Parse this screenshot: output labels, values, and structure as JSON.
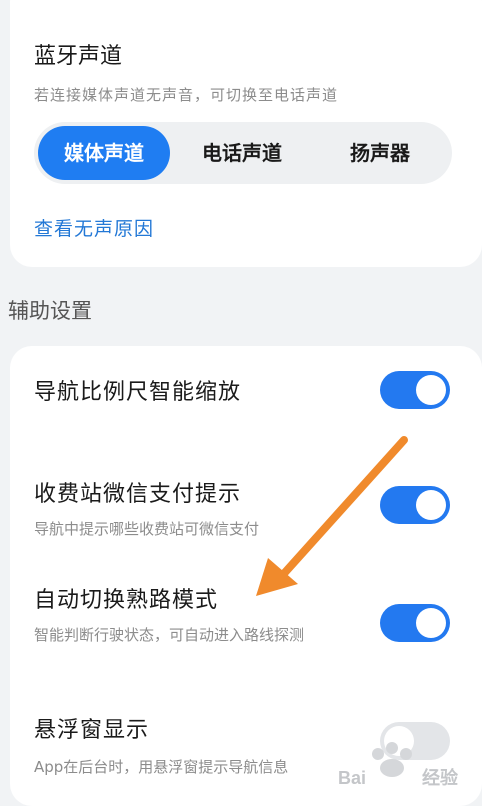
{
  "bluetooth": {
    "title": "蓝牙声道",
    "subtitle": "若连接媒体声道无声音，可切换至电话声道",
    "segments": [
      {
        "label": "媒体声道",
        "active": true
      },
      {
        "label": "电话声道",
        "active": false
      },
      {
        "label": "扬声器",
        "active": false
      }
    ],
    "link": "查看无声原因"
  },
  "aux": {
    "section_title": "辅助设置",
    "rows": [
      {
        "title": "导航比例尺智能缩放",
        "subtitle": "",
        "enabled": true
      },
      {
        "title": "收费站微信支付提示",
        "subtitle": "导航中提示哪些收费站可微信支付",
        "enabled": true
      },
      {
        "title": "自动切换熟路模式",
        "subtitle": "智能判断行驶状态，可自动进入路线探测",
        "enabled": true
      },
      {
        "title": "悬浮窗显示",
        "subtitle": "App在后台时，用悬浮窗提示导航信息",
        "enabled": false
      }
    ]
  },
  "colors": {
    "accent": "#1f7df2",
    "arrow": "#f08a2c"
  },
  "watermark": {
    "text": "Bai度经验"
  }
}
